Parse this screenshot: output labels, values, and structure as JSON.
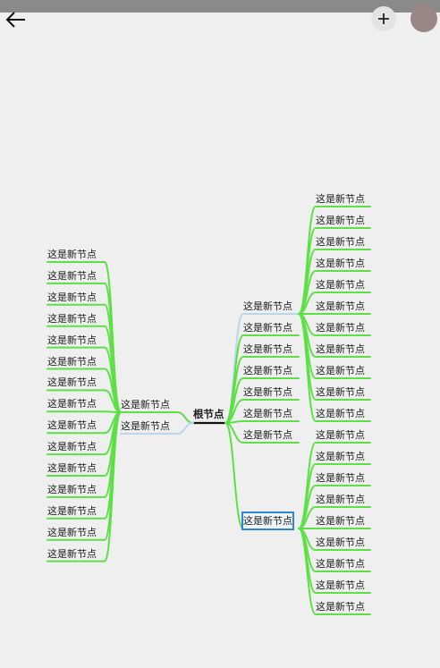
{
  "app": {
    "icons": {
      "back": "arrow-left-icon",
      "add": "plus-icon",
      "avatar": "user-avatar"
    },
    "colors": {
      "background": "#efefef",
      "branch_green": "#5ce046",
      "branch_light_blue": "#b9d7ee",
      "root_line": "#111111",
      "selected_border": "#2f86d6"
    }
  },
  "mindmap": {
    "root": {
      "label": "根节点"
    },
    "left": [
      {
        "label": "这是新节点",
        "children": [
          "这是新节点",
          "这是新节点",
          "这是新节点",
          "这是新节点",
          "这是新节点",
          "这是新节点",
          "这是新节点",
          "这是新节点",
          "这是新节点",
          "这是新节点",
          "这是新节点",
          "这是新节点",
          "这是新节点",
          "这是新节点",
          "这是新节点"
        ]
      },
      {
        "label": "这是新节点",
        "children": []
      }
    ],
    "right": [
      {
        "label": "这是新节点",
        "children": [
          "这是新节点",
          "这是新节点",
          "这是新节点",
          "这是新节点",
          "这是新节点",
          "这是新节点",
          "这是新节点",
          "这是新节点",
          "这是新节点",
          "这是新节点",
          "这是新节点"
        ]
      },
      {
        "label": "这是新节点",
        "children": []
      },
      {
        "label": "这是新节点",
        "children": []
      },
      {
        "label": "这是新节点",
        "children": []
      },
      {
        "label": "这是新节点",
        "children": []
      },
      {
        "label": "这是新节点",
        "children": []
      },
      {
        "label": "这是新节点",
        "children": []
      },
      {
        "label": "这是新节点",
        "selected": true,
        "children": [
          "这是新节点",
          "这是新节点",
          "这是新节点",
          "这是新节点",
          "这是新节点",
          "这是新节点",
          "这是新节点",
          "这是新节点",
          "这是新节点"
        ]
      }
    ]
  }
}
